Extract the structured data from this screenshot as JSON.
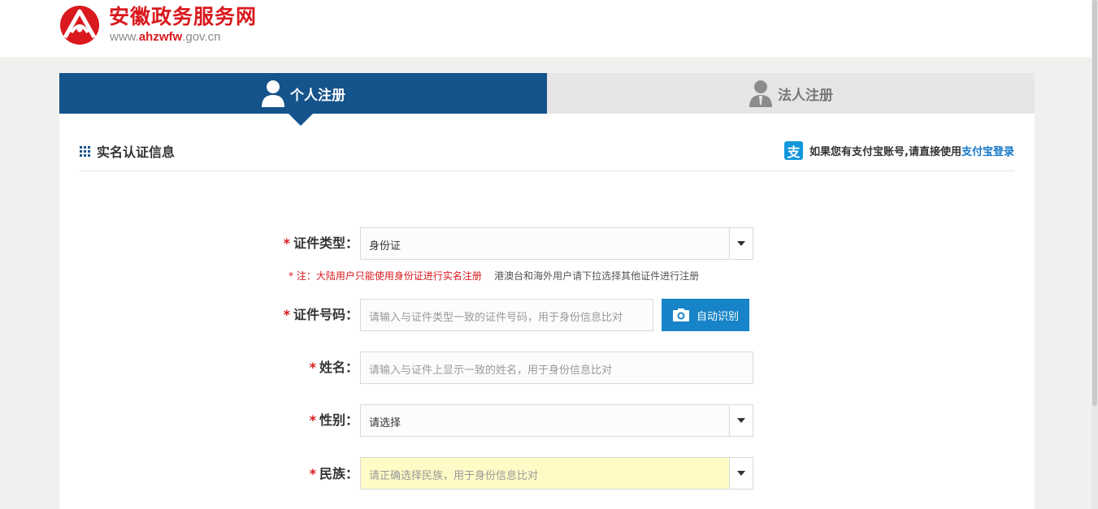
{
  "site": {
    "name": "安徽政务服务网",
    "url_prefix": "www.",
    "url_brand": "ahzwfw",
    "url_suffix": ".gov.cn"
  },
  "tabs": [
    {
      "label": "个人注册",
      "active": true,
      "icon": "person-icon"
    },
    {
      "label": "法人注册",
      "active": false,
      "icon": "business-person-icon"
    }
  ],
  "section": {
    "title": "实名认证信息",
    "alipay_hint": "如果您有支付宝账号,请直接使用",
    "alipay_link": "支付宝登录",
    "alipay_icon_glyph": "支"
  },
  "form": {
    "required_mark": "*",
    "id_type": {
      "label": "证件类型：",
      "value": "身份证"
    },
    "note": {
      "red": "* 注：大陆用户只能使用身份证进行实名注册",
      "gray": "港澳台和海外用户请下拉选择其他证件进行注册"
    },
    "id_number": {
      "label": "证件号码：",
      "placeholder": "请输入与证件类型一致的证件号码，用于身份信息比对"
    },
    "scan_button": "自动识别",
    "name": {
      "label": "姓名：",
      "placeholder": "请输入与证件上显示一致的姓名，用于身份信息比对"
    },
    "gender": {
      "label": "性别：",
      "value": "请选择"
    },
    "ethnicity": {
      "label": "民族：",
      "placeholder": "请正确选择民族，用于身份信息比对"
    }
  },
  "colors": {
    "brand_red": "#d9191e",
    "tab_active": "#14538b",
    "button_blue": "#1783c8",
    "highlight_yellow": "#fefbc6"
  }
}
